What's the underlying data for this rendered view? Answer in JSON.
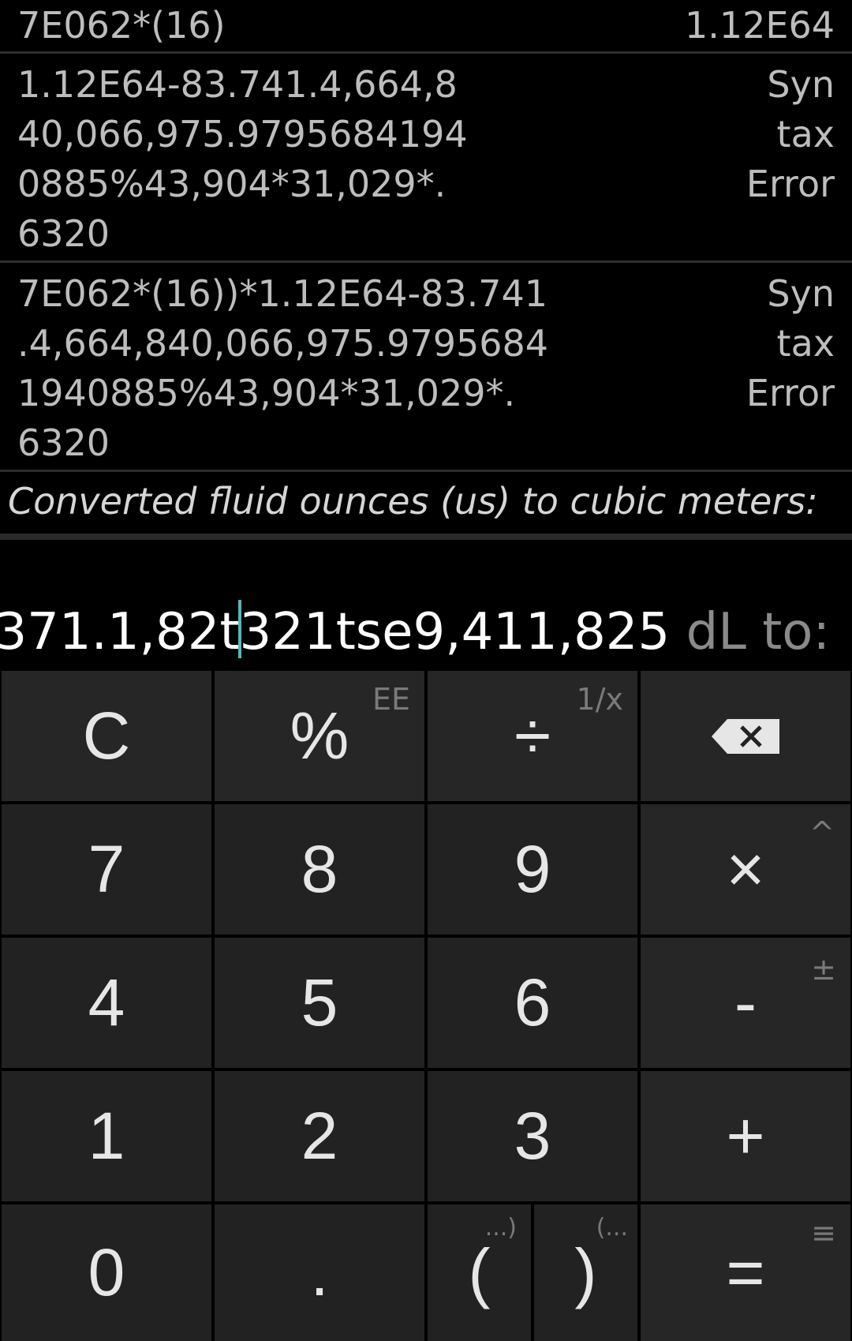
{
  "history": [
    {
      "expr": "7E062*(16)",
      "result": "1.12E64"
    },
    {
      "expr": "1.12E64-83.741.4,664,8\n40,066,975.9795684194\n0885%43,904*31,029*.\n6320",
      "result": "Syn\ntax\nError"
    },
    {
      "expr": "7E062*(16))*1.12E64-83.741\n.4,664,840,066,975.9795684\n1940885%43,904*31,029*.\n6320",
      "result": "Syn\ntax\nError"
    }
  ],
  "conversion_label": "Converted fluid ounces (us) to cubic meters:",
  "input": {
    "before_caret": "371.1,82t",
    "after_caret": "321tse9,411,825",
    "suffix": " dL to:"
  },
  "keys": {
    "clear": "C",
    "percent": "%",
    "percent_alt": "EE",
    "divide": "÷",
    "divide_alt": "1/x",
    "backspace": "backspace-icon",
    "seven": "7",
    "eight": "8",
    "nine": "9",
    "multiply": "×",
    "multiply_alt": "^",
    "four": "4",
    "five": "5",
    "six": "6",
    "minus": "-",
    "minus_alt": "±",
    "one": "1",
    "two": "2",
    "three": "3",
    "plus": "+",
    "zero": "0",
    "decimal": ".",
    "open_paren": "(",
    "open_paren_alt": "...)",
    "close_paren": ")",
    "close_paren_alt": "(...",
    "equals": "=",
    "equals_alt": "≡"
  },
  "colors": {
    "background": "#000000",
    "key": "#222222",
    "caret": "#5fb3b3",
    "text": "#e6e6e6",
    "muted": "#7a7a7a"
  }
}
